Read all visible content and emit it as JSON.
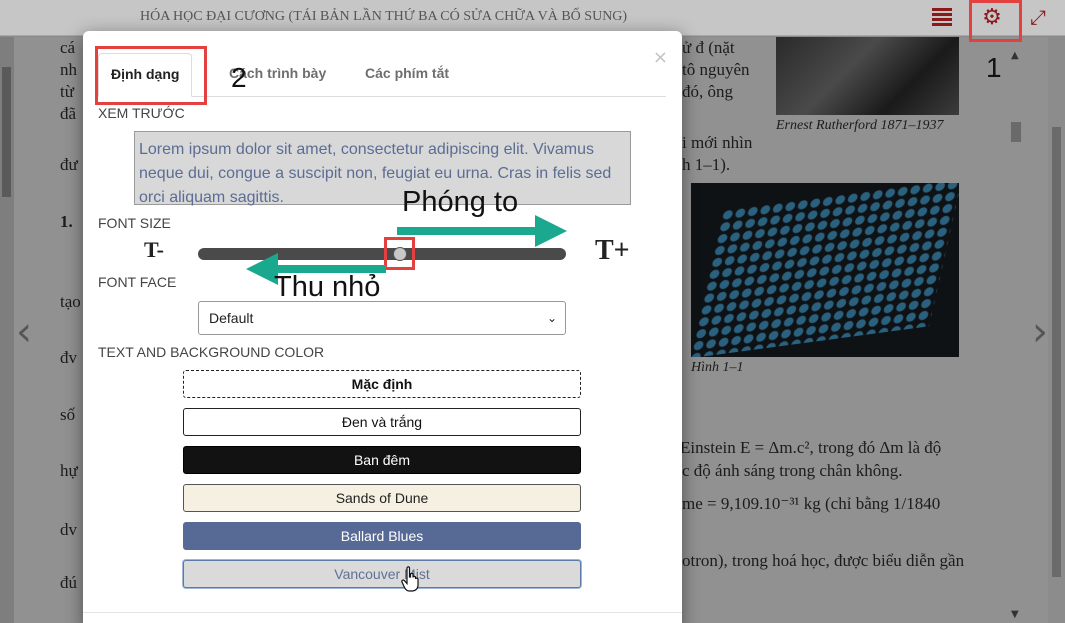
{
  "reader": {
    "book_title": "HÓA HỌC ĐẠI CƯƠNG (TÁI BẢN LẦN THỨ BA CÓ SỬA CHỮA VÀ BỔ SUNG)",
    "toolbar_icons": [
      "toc-list-icon",
      "gear-icon",
      "expand-icon"
    ],
    "brand_color": "#8b1a1a",
    "nav_prev": "‹",
    "nav_next": "›",
    "background_fragments": [
      "cá",
      "nh",
      "từ",
      "đã",
      "đư",
      "1.",
      "tạo",
      "đv",
      "số",
      "hự",
      "dv",
      "đú",
      "ử đ (nặt",
      "tô nguyên",
      "đó, ông",
      "i mới nhìn",
      "h 1–1).",
      "Einstein E = Δm.c², trong đó Δm là độ",
      "c độ ánh sáng trong chân không.",
      "me = 9,109.10⁻³¹ kg (chỉ bằng 1/1840",
      "otron), trong hoá học, được biểu diễn gần"
    ],
    "caption_photo1": "Ernest Rutherford 1871–1937",
    "caption_photo2": "Hình 1–1"
  },
  "modal": {
    "close_glyph": "×",
    "tabs": [
      {
        "label": "Định dạng",
        "active": true
      },
      {
        "label": "Cách trình bày",
        "active": false
      },
      {
        "label": "Các phím tắt",
        "active": false
      }
    ],
    "preview_label": "XEM TRƯỚC",
    "preview_text": "Lorem ipsum dolor sit amet, consectetur adipiscing elit. Vivamus neque dui, congue a suscipit non, feugiat eu urna. Cras in felis sed orci aliquam sagittis.",
    "font_size_label": "FONT SIZE",
    "font_size_minus": "T-",
    "font_size_plus": "T+",
    "font_size_level": 0.55,
    "font_face_label": "FONT FACE",
    "font_face_value": "Default",
    "color_label": "TEXT AND BACKGROUND COLOR",
    "themes": [
      {
        "label": "Mặc định",
        "bg": "#ffffff",
        "fg": "#111111"
      },
      {
        "label": "Đen và trắng",
        "bg": "#ffffff",
        "fg": "#111111"
      },
      {
        "label": "Ban đêm",
        "bg": "#121212",
        "fg": "#ffffff"
      },
      {
        "label": "Sands of Dune",
        "bg": "#f6f0e3",
        "fg": "#222222"
      },
      {
        "label": "Ballard Blues",
        "bg": "#576a96",
        "fg": "#ffffff"
      },
      {
        "label": "Vancouver Mist",
        "bg": "#dadada",
        "fg": "#5f7196"
      }
    ]
  },
  "annotations": {
    "number_1": "1",
    "number_2": "2",
    "zoom_in": "Phóng to",
    "zoom_out": "Thu nhỏ",
    "highlight_color": "#e34040",
    "arrow_color": "#1aa88e"
  }
}
